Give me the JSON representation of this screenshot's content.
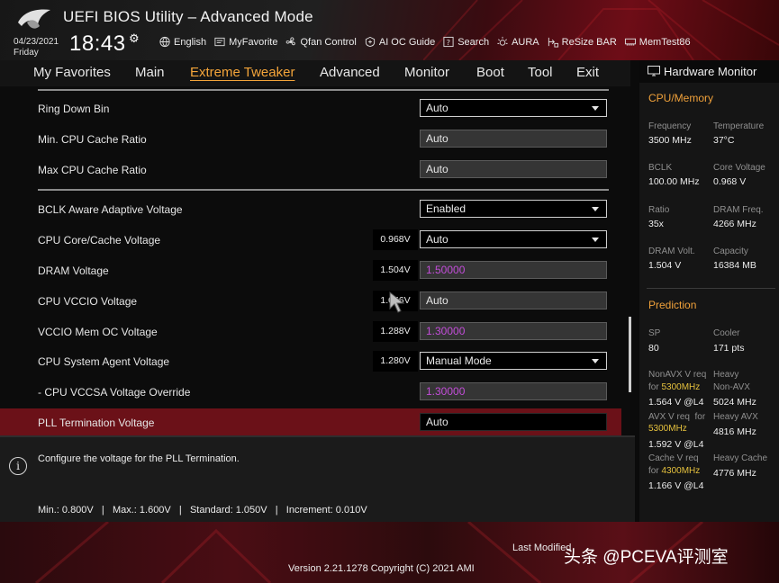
{
  "app": {
    "title": "UEFI BIOS Utility – Advanced Mode"
  },
  "header": {
    "date": "04/23/2021",
    "day": "Friday",
    "time": "18:43",
    "toolbar": [
      {
        "label": "English",
        "icon": "globe-icon"
      },
      {
        "label": "MyFavorite",
        "icon": "favorite-icon"
      },
      {
        "label": "Qfan Control",
        "icon": "fan-icon"
      },
      {
        "label": "AI OC Guide",
        "icon": "ai-guide-icon"
      },
      {
        "label": "Search",
        "icon": "search-icon"
      },
      {
        "label": "AURA",
        "icon": "aura-icon"
      },
      {
        "label": "ReSize BAR",
        "icon": "resize-bar-icon"
      },
      {
        "label": "MemTest86",
        "icon": "memtest-icon"
      }
    ]
  },
  "nav": {
    "tabs": [
      {
        "label": "My Favorites"
      },
      {
        "label": "Main"
      },
      {
        "label": "Extreme Tweaker",
        "active": true
      },
      {
        "label": "Advanced"
      },
      {
        "label": "Monitor"
      },
      {
        "label": "Boot"
      },
      {
        "label": "Tool"
      },
      {
        "label": "Exit"
      }
    ]
  },
  "settings": [
    {
      "label": "Ring Down Bin",
      "control": "dropdown",
      "value": "Auto"
    },
    {
      "label": "Min. CPU Cache Ratio",
      "control": "field",
      "value": "Auto"
    },
    {
      "label": "Max CPU Cache Ratio",
      "control": "field",
      "value": "Auto"
    },
    {
      "label": "BCLK Aware Adaptive Voltage",
      "control": "dropdown",
      "value": "Enabled"
    },
    {
      "label": "CPU Core/Cache Voltage",
      "readout": "0.968V",
      "control": "dropdown",
      "value": "Auto"
    },
    {
      "label": "DRAM Voltage",
      "readout": "1.504V",
      "control": "field",
      "value": "1.50000",
      "color": "#c24dd8"
    },
    {
      "label": "CPU VCCIO Voltage",
      "readout": "1.056V",
      "control": "field",
      "value": "Auto"
    },
    {
      "label": "VCCIO Mem OC Voltage",
      "readout": "1.288V",
      "control": "field",
      "value": "1.30000",
      "color": "#c24dd8"
    },
    {
      "label": "CPU System Agent Voltage",
      "readout": "1.280V",
      "control": "dropdown",
      "value": "Manual Mode"
    },
    {
      "label": "- CPU VCCSA Voltage Override",
      "control": "field",
      "value": "1.30000",
      "color": "#c24dd8"
    },
    {
      "label": "PLL Termination Voltage",
      "control": "field",
      "value": "Auto",
      "selected": true
    }
  ],
  "help": {
    "description": "Configure the voltage for the PLL Termination.",
    "limits": "Min.: 0.800V   |   Max.: 1.600V   |   Standard: 1.050V   |   Increment: 0.010V"
  },
  "hw_monitor": {
    "title": "Hardware Monitor",
    "cpu_memory": {
      "title": "CPU/Memory",
      "items": [
        {
          "label": "Frequency",
          "value": "3500 MHz"
        },
        {
          "label": "Temperature",
          "value": "37°C"
        },
        {
          "label": "BCLK",
          "value": "100.00 MHz"
        },
        {
          "label": "Core Voltage",
          "value": "0.968 V"
        },
        {
          "label": "Ratio",
          "value": "35x"
        },
        {
          "label": "DRAM Freq.",
          "value": "4266 MHz"
        },
        {
          "label": "DRAM Volt.",
          "value": "1.504 V"
        },
        {
          "label": "Capacity",
          "value": "16384 MB"
        }
      ]
    },
    "prediction": {
      "title": "Prediction",
      "sp_label": "SP",
      "sp_value": "80",
      "cooler_label": "Cooler",
      "cooler_value": "171 pts",
      "nonavx_label": "NonAVX V req",
      "nonavx_for": "for",
      "nonavx_freq": "5300MHz",
      "nonavx_value": "1.564 V @L4",
      "heavy_nonavx_label": "Heavy",
      "heavy_nonavx_label2": "Non-AVX",
      "heavy_nonavx_value": "5024 MHz",
      "avx_label": "AVX V req",
      "avx_for": "for",
      "avx_freq": "5300MHz",
      "avx_value": "1.592 V @L4",
      "heavy_avx_label": "Heavy AVX",
      "heavy_avx_value": "4816 MHz",
      "cache_label": "Cache V req",
      "cache_for": "for",
      "cache_freq": "4300MHz",
      "cache_value": "1.166 V @L4",
      "heavy_cache_label": "Heavy Cache",
      "heavy_cache_value": "4776 MHz"
    }
  },
  "footer": {
    "last_modified": "Last Modified",
    "version": "Version 2.21.1278 Copyright (C) 2021 AMI",
    "watermark": "头条 @PCEVA评测室"
  },
  "colors": {
    "accent": "#f3a43a",
    "highlight": "#6b1118",
    "value_pink": "#c24dd8",
    "prediction_yellow": "#e5c13d"
  }
}
